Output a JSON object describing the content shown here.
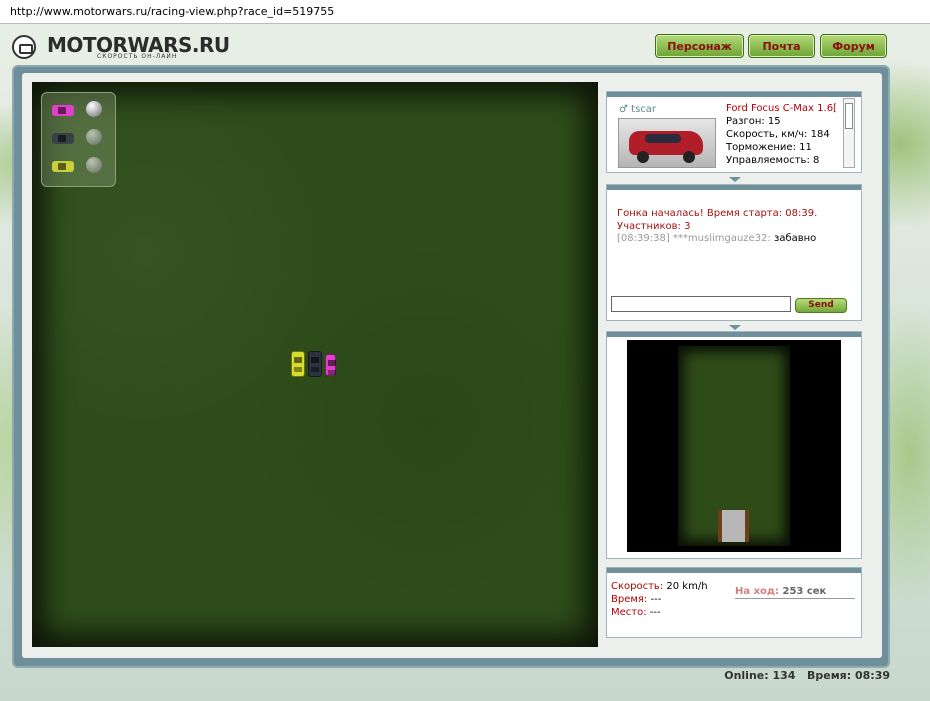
{
  "browser": {
    "url": "http://www.motorwars.ru/racing-view.php?race_id=519755"
  },
  "header": {
    "logo_text": "MOTORWARS.RU",
    "logo_tagline": "СКОРОСТЬ ОН-ЛАЙН",
    "nav": [
      {
        "label": "Персонаж"
      },
      {
        "label": "Почта"
      },
      {
        "label": "Форум"
      }
    ]
  },
  "race": {
    "legend": [
      {
        "color": "#e040c8",
        "name": "pink-car"
      },
      {
        "color": "#3a4048",
        "name": "dark-car"
      },
      {
        "color": "#c9cf3a",
        "name": "yellow-car"
      }
    ]
  },
  "car_info": {
    "username": "tscar",
    "car_name": "Ford Focus C-Max 1.6[",
    "specs": [
      "Разгон: 15",
      "Скорость, км/ч: 184",
      "Торможение: 11",
      "Управляемость: 8"
    ]
  },
  "chat": {
    "system_lines": [
      "Гонка началась! Время старта: 08:39.",
      "Участников: 3"
    ],
    "message": {
      "time": "[08:39:38]",
      "author": "***muslimgauze32:",
      "text": "забавно"
    },
    "input_value": "",
    "send_label": "Send"
  },
  "stats": {
    "speed_label": "Скорость:",
    "speed_value": "20 km/h",
    "time_label": "Время:",
    "time_value": "---",
    "place_label": "Место:",
    "place_value": "---",
    "turn_label": "На ход:",
    "turn_value": "253 сек"
  },
  "footer": {
    "online_label": "Online:",
    "online_value": "134",
    "time_label": "Время:",
    "time_value": "08:39"
  }
}
